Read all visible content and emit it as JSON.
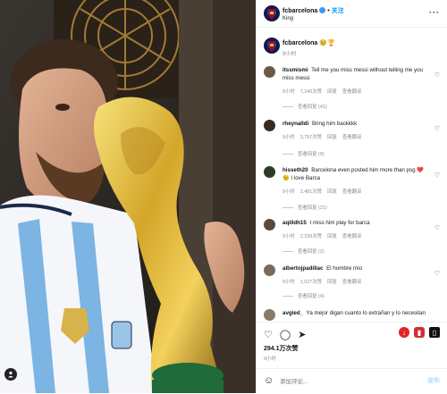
{
  "header": {
    "username": "fcbarcelona",
    "follow_label": "关注",
    "subtitle": "King",
    "more_icon": "more-icon"
  },
  "caption": {
    "username": "fcbarcelona",
    "emojis": "🥹🏆",
    "time": "9小时"
  },
  "comments": [
    {
      "username": "itssmismi",
      "text": "Tell me you miss messi without telling me you miss messi",
      "time": "9小时",
      "likes": "7,240次赞",
      "reply": "回复",
      "translate": "查看翻译",
      "view_replies": "查看回复 (41)"
    },
    {
      "username": "rheynalldi",
      "text": "Bring him backkkk",
      "time": "9小时",
      "likes": "3,797次赞",
      "reply": "回复",
      "translate": "查看翻译",
      "view_replies": "查看回复 (9)"
    },
    {
      "username": "hisseth20",
      "text": "Barcelona even posted him more than psg ❤️😉 I love Barca",
      "time": "9小时",
      "likes": "2,481次赞",
      "reply": "回复",
      "translate": "查看翻译",
      "view_replies": "查看回复 (21)"
    },
    {
      "username": "aqilldh15",
      "text": "I miss him play for barca",
      "time": "9小时",
      "likes": "2,239次赞",
      "reply": "回复",
      "translate": "查看翻译",
      "view_replies": "查看回复 (2)"
    },
    {
      "username": "albertojpadillac",
      "text": "El hombre mio",
      "time": "9小时",
      "likes": "1,027次赞",
      "reply": "回复",
      "translate": "查看翻译",
      "view_replies": "查看回复 (4)"
    },
    {
      "username": "avgied_",
      "text": "Ya mejor digan cuanto lo extrañan y lo necesitan"
    }
  ],
  "actions": {
    "likes_count": "294.1万次赞",
    "post_time": "9小时"
  },
  "add_comment": {
    "placeholder": "添加评论...",
    "post_label": "发布"
  }
}
